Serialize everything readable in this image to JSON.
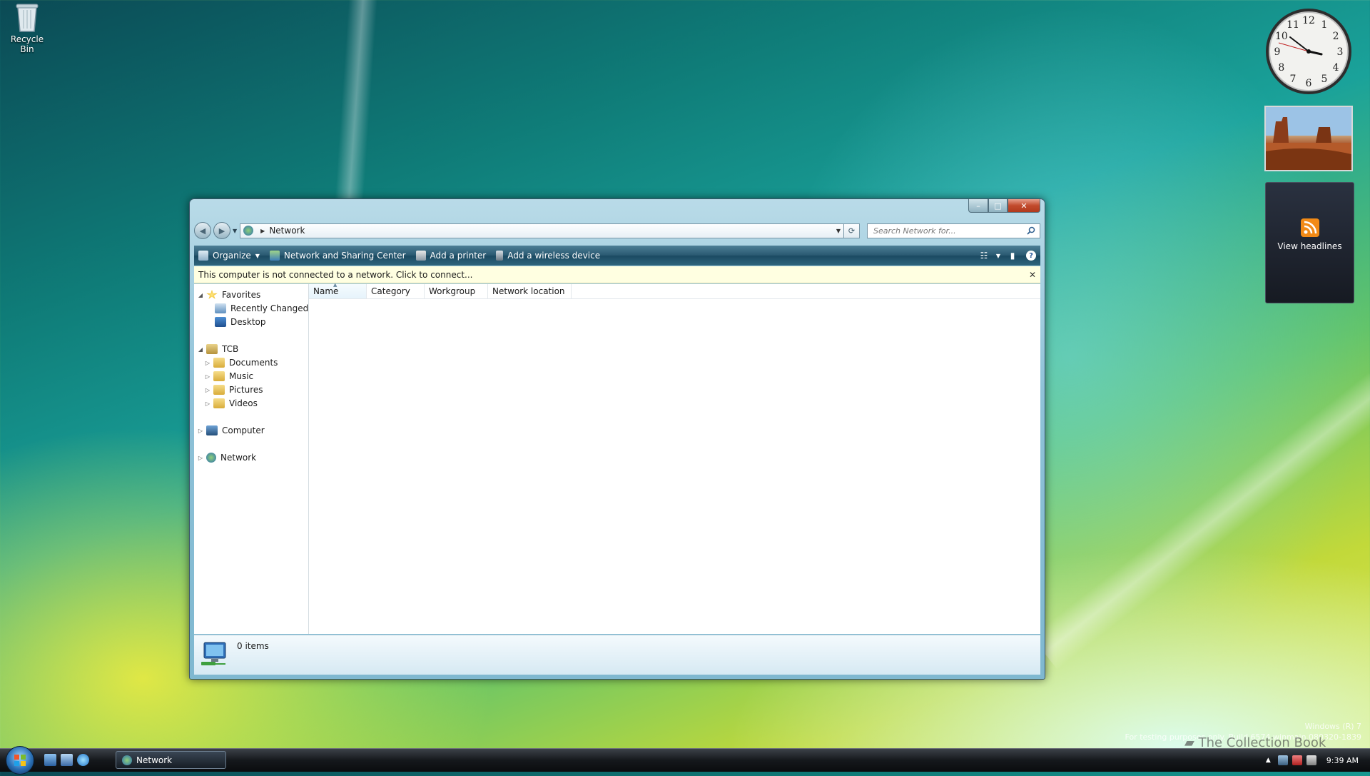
{
  "desktop": {
    "recycle_bin_label": "Recycle Bin",
    "watermark": {
      "line1": "Windows (R) 7",
      "line2": "For testing purposes only. Build 6574.winmain.080320-1839"
    },
    "book_watermark": "The Collection Book"
  },
  "gadgets": {
    "clock_numbers": [
      "12",
      "1",
      "2",
      "3",
      "4",
      "5",
      "6",
      "7",
      "8",
      "9",
      "10",
      "11"
    ],
    "feed_label": "View headlines"
  },
  "window": {
    "caption_buttons": {
      "minimize": "–",
      "maximize": "□",
      "close": "✕"
    },
    "address": {
      "path": "Network"
    },
    "search": {
      "placeholder": "Search Network for..."
    },
    "commands": [
      {
        "label": "Organize"
      },
      {
        "label": "Network and Sharing Center"
      },
      {
        "label": "Add a printer"
      },
      {
        "label": "Add a wireless device"
      }
    ],
    "infobar": {
      "message": "This computer is not connected to a network. Click to connect...",
      "close": "✕"
    },
    "nav_pane": {
      "favorites": "Favorites",
      "recently_changed": "Recently Changed",
      "desktop": "Desktop",
      "user": "TCB",
      "documents": "Documents",
      "music": "Music",
      "pictures": "Pictures",
      "videos": "Videos",
      "computer": "Computer",
      "network": "Network"
    },
    "columns": [
      "Name",
      "Category",
      "Workgroup",
      "Network location"
    ],
    "details": {
      "count": "0 items"
    }
  },
  "taskbar": {
    "active_window": "Network",
    "time": "9:39 AM"
  },
  "colors": {
    "cmdbar": "#2a5a72",
    "infobar": "#ffffe1",
    "close_button": "#c24a2c"
  }
}
